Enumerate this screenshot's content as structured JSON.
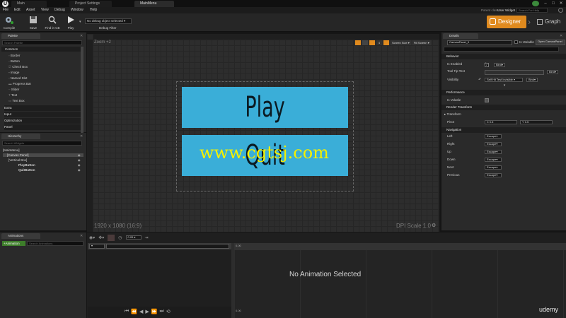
{
  "title_bar": {
    "tabs": [
      "Main",
      "Project Settings",
      "MainMenu"
    ]
  },
  "menu": {
    "items": [
      "File",
      "Edit",
      "Asset",
      "View",
      "Debug",
      "Window",
      "Help"
    ],
    "parent_class_label": "Parent class:",
    "parent_class_value": "User Widget",
    "search_help_placeholder": "Search For Help"
  },
  "toolbar": {
    "compile": "Compile",
    "save": "Save",
    "find_in_cb": "Find in CB",
    "play": "Play",
    "debug_select": "No debug object selected",
    "debug_filter": "Debug Filter",
    "designer": "Designer",
    "graph": "Graph"
  },
  "palette": {
    "title": "Palette",
    "search_placeholder": "Search Palette",
    "categories": [
      "Common",
      "Extra",
      "Input",
      "Optimization",
      "Panel"
    ],
    "items": [
      "Border",
      "Button",
      "Check Box",
      "Image",
      "Named Slot",
      "Progress Bar",
      "Slider",
      "Text",
      "Text Box"
    ]
  },
  "hierarchy": {
    "title": "Hierarchy",
    "search_placeholder": "Search Widgets",
    "items": [
      "[MainMenu]",
      "[Canvas Panel]",
      "[Vertical Box]",
      "PlayButton",
      "QuitButton"
    ]
  },
  "animations": {
    "title": "Animations",
    "add_button": "+Animation",
    "search_placeholder": "Search Animations"
  },
  "viewport": {
    "zoom": "Zoom +2",
    "resolution": "1920 x 1080 (16:9)",
    "dpi_scale": "DPI Scale 1.0",
    "screen_size": "Screen Size",
    "fill_screen": "Fill Screen",
    "grid_value": "4",
    "play_text": "Play",
    "quit_text": "Quit",
    "watermark": "www.cgtsj.com",
    "colors": {
      "button": "#3aaed8",
      "accent": "#e08a1e",
      "watermark": "#f4f000"
    }
  },
  "details": {
    "title": "Details",
    "name_value": "CanvasPanel_0",
    "is_variable": "Is Variable",
    "open_button": "Open CanvasPanel",
    "behavior": {
      "header": "Behavior",
      "is_enabled": "Is Enabled",
      "tool_tip_text": "Tool Tip Text",
      "visibility": "Visibility",
      "visibility_value": "Self Hit Test Invisible",
      "bind": "Bind"
    },
    "performance": {
      "header": "Performance",
      "is_volatile": "Is Volatile"
    },
    "render_transform": {
      "header": "Render Transform",
      "transform": "Transform",
      "pivot": "Pivot",
      "pivot_x": "X 0.5",
      "pivot_y": "Y 0.5"
    },
    "navigation": {
      "header": "Navigation",
      "rows": [
        {
          "label": "Left",
          "value": "Escape"
        },
        {
          "label": "Right",
          "value": "Escape"
        },
        {
          "label": "Up",
          "value": "Escape"
        },
        {
          "label": "Down",
          "value": "Escape"
        },
        {
          "label": "Next",
          "value": "Escape"
        },
        {
          "label": "Previous",
          "value": "Escape"
        }
      ]
    }
  },
  "timeline": {
    "speed": "0.05",
    "start_time": "0.00",
    "no_animation": "No Animation Selected",
    "brand": "udemy"
  }
}
